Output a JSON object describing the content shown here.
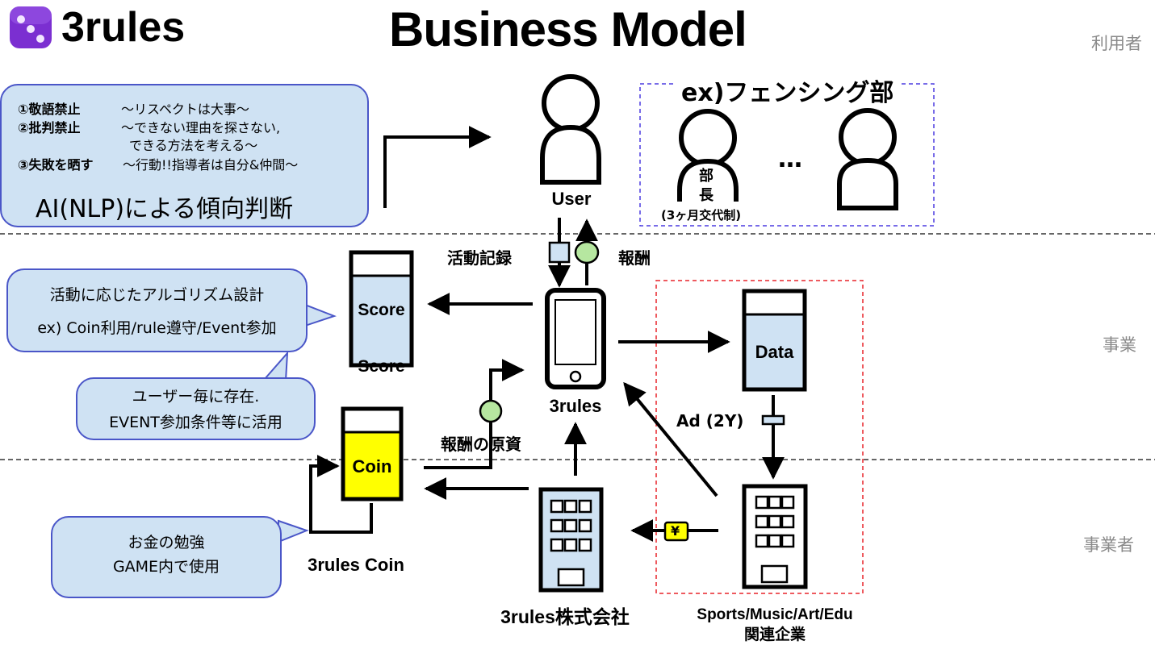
{
  "header": {
    "brand_name": "3rules",
    "title": "Business Model"
  },
  "zones": {
    "users": "利用者",
    "business": "事業",
    "operators": "事業者"
  },
  "rules_bubble": {
    "rules": [
      {
        "name": "①敬語禁止",
        "desc": "〜リスペクトは大事〜"
      },
      {
        "name": "②批判禁止",
        "desc": "〜できない理由を探さない,"
      },
      {
        "name": "",
        "desc": "できる方法を考える〜"
      },
      {
        "name": "③失敗を晒す",
        "desc": "〜行動!!指導者は自分&仲間〜"
      }
    ],
    "ai_label": "AI(NLP)による傾向判断"
  },
  "user_node": {
    "label": "User"
  },
  "club": {
    "title": "ex)フェンシング部",
    "leader_line1": "部",
    "leader_line2": "長",
    "leader_note": "(3ヶ月交代制)",
    "ellipsis": "…"
  },
  "flows": {
    "activity_record": "活動記録",
    "reward": "報酬",
    "reward_source": "報酬の原資",
    "ad": "Ad (2Y)",
    "yen_symbol": "¥"
  },
  "score": {
    "box_label": "Score",
    "caption": "Score"
  },
  "score_bubble": {
    "line1": "活動に応じたアルゴリズム設計",
    "line2": "ex) Coin利用/rule遵守/Event参加"
  },
  "existence_bubble": {
    "line1": "ユーザー毎に存在.",
    "line2": "EVENT参加条件等に活用"
  },
  "app": {
    "label": "3rules"
  },
  "data_node": {
    "box_label": "Data"
  },
  "coin": {
    "box_label": "Coin",
    "caption": "3rules Coin"
  },
  "coin_bubble": {
    "line1": "お金の勉強",
    "line2": "GAME内で使用"
  },
  "company": {
    "label": "3rules株式会社"
  },
  "partners": {
    "line1": "Sports/Music/Art/Edu",
    "line2": "関連企業"
  },
  "colors": {
    "bubble_fill": "#cfe2f3",
    "bubble_border": "#4a56c8",
    "cylinder_fill": "#cfe2f3",
    "coin_fill": "#ffff00",
    "token_green": "#b6e7a0",
    "partner_frame": "#e8232a",
    "club_frame": "#4b3be0",
    "divider": "#333333",
    "logo": "#7b2fd1"
  }
}
